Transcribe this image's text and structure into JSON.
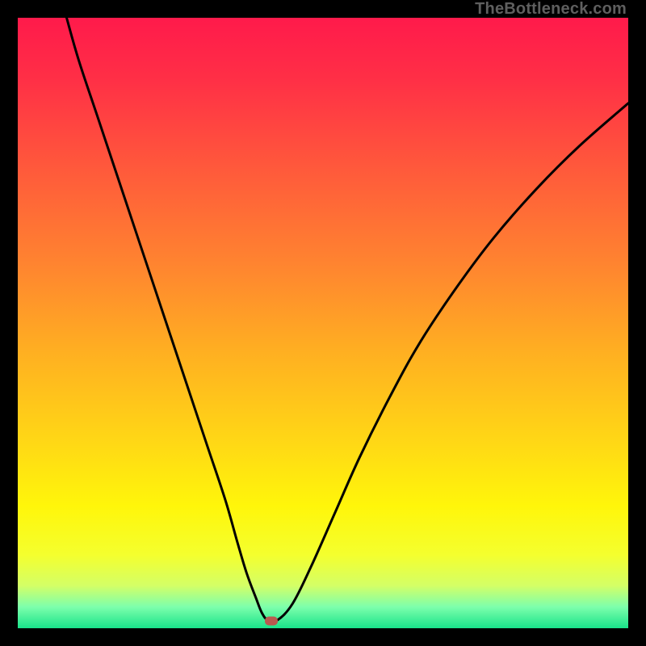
{
  "watermark": {
    "text": "TheBottleneck.com"
  },
  "colors": {
    "bg_black": "#000000",
    "curve": "#000000",
    "marker": "#b9594f",
    "gradient_stops": [
      {
        "offset": 0.0,
        "color": "#ff1a4b"
      },
      {
        "offset": 0.1,
        "color": "#ff2f46"
      },
      {
        "offset": 0.25,
        "color": "#ff5a3b"
      },
      {
        "offset": 0.4,
        "color": "#ff8330"
      },
      {
        "offset": 0.55,
        "color": "#ffb021"
      },
      {
        "offset": 0.7,
        "color": "#ffd915"
      },
      {
        "offset": 0.8,
        "color": "#fff60a"
      },
      {
        "offset": 0.88,
        "color": "#f4ff2e"
      },
      {
        "offset": 0.93,
        "color": "#d4ff66"
      },
      {
        "offset": 0.965,
        "color": "#7dffac"
      },
      {
        "offset": 1.0,
        "color": "#19e38a"
      }
    ]
  },
  "chart_data": {
    "type": "line",
    "title": "",
    "xlabel": "",
    "ylabel": "",
    "xlim": [
      0,
      100
    ],
    "ylim": [
      0,
      100
    ],
    "grid": false,
    "legend": false,
    "series": [
      {
        "name": "bottleneck-curve",
        "x": [
          8,
          10,
          13,
          16,
          19,
          22,
          25,
          28,
          31,
          34,
          36,
          37.5,
          39,
          40,
          41,
          42.5,
          45,
          48,
          52,
          56,
          61,
          66,
          72,
          78,
          85,
          92,
          100
        ],
        "y": [
          100,
          93,
          84,
          75,
          66,
          57,
          48,
          39,
          30,
          21,
          14,
          9,
          5,
          2.5,
          1.3,
          1.3,
          4,
          10,
          19,
          28,
          38,
          47,
          56,
          64,
          72,
          79,
          86
        ]
      }
    ],
    "annotations": [
      {
        "name": "optimal-marker",
        "x": 41.6,
        "y": 1.2
      }
    ]
  }
}
